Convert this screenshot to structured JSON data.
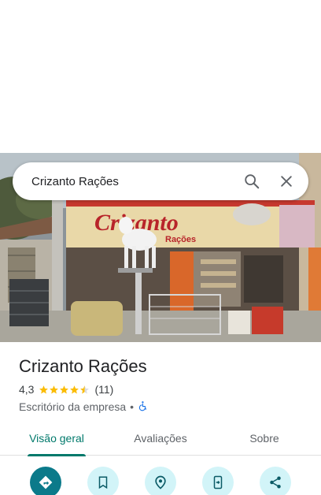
{
  "search": {
    "query": "Crizanto Rações"
  },
  "photo": {
    "sign_text": "Crizanto",
    "sign_sub": "Rações"
  },
  "place": {
    "name": "Crizanto Rações",
    "rating": "4,3",
    "stars_filled": 4.3,
    "reviews_count": "(11)",
    "category": "Escritório da empresa",
    "separator": "•"
  },
  "tabs": [
    {
      "label": "Visão geral",
      "active": true
    },
    {
      "label": "Avaliações",
      "active": false
    },
    {
      "label": "Sobre",
      "active": false
    }
  ],
  "actions": [
    {
      "icon": "directions-icon"
    },
    {
      "icon": "bookmark-icon"
    },
    {
      "icon": "nearby-icon"
    },
    {
      "icon": "send-to-phone-icon"
    },
    {
      "icon": "share-icon"
    }
  ],
  "colors": {
    "accent": "#00796b",
    "action_bg": "#d2f4f8",
    "primary_action": "#0b7a8a",
    "star": "#fbbc04"
  }
}
